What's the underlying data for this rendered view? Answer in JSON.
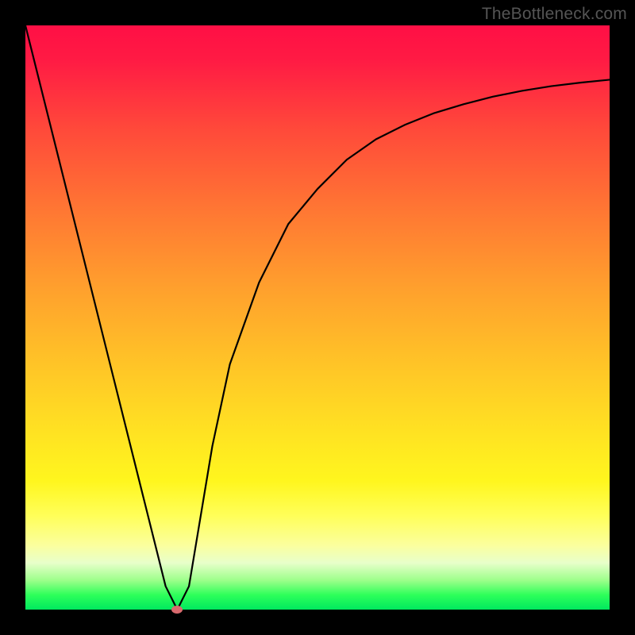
{
  "watermark": "TheBottleneck.com",
  "chart_data": {
    "type": "line",
    "title": "",
    "xlabel": "",
    "ylabel": "",
    "xlim": [
      0,
      100
    ],
    "ylim": [
      0,
      100
    ],
    "grid": false,
    "legend": false,
    "series": [
      {
        "name": "curve",
        "x": [
          0,
          5,
          10,
          15,
          20,
          24,
          26,
          28,
          30,
          32,
          35,
          40,
          45,
          50,
          55,
          60,
          65,
          70,
          75,
          80,
          85,
          90,
          95,
          100
        ],
        "y": [
          100,
          80,
          60,
          40,
          20,
          4,
          0,
          4,
          16,
          28,
          42,
          56,
          66,
          72,
          77,
          80.5,
          83,
          85,
          86.5,
          87.8,
          88.8,
          89.6,
          90.2,
          90.7
        ]
      }
    ],
    "marker": {
      "x": 26,
      "y": 0
    },
    "colors": {
      "curve": "#000000",
      "marker": "#d96a6e",
      "gradient_top": "#ff0f45",
      "gradient_bottom": "#00e85e"
    }
  }
}
